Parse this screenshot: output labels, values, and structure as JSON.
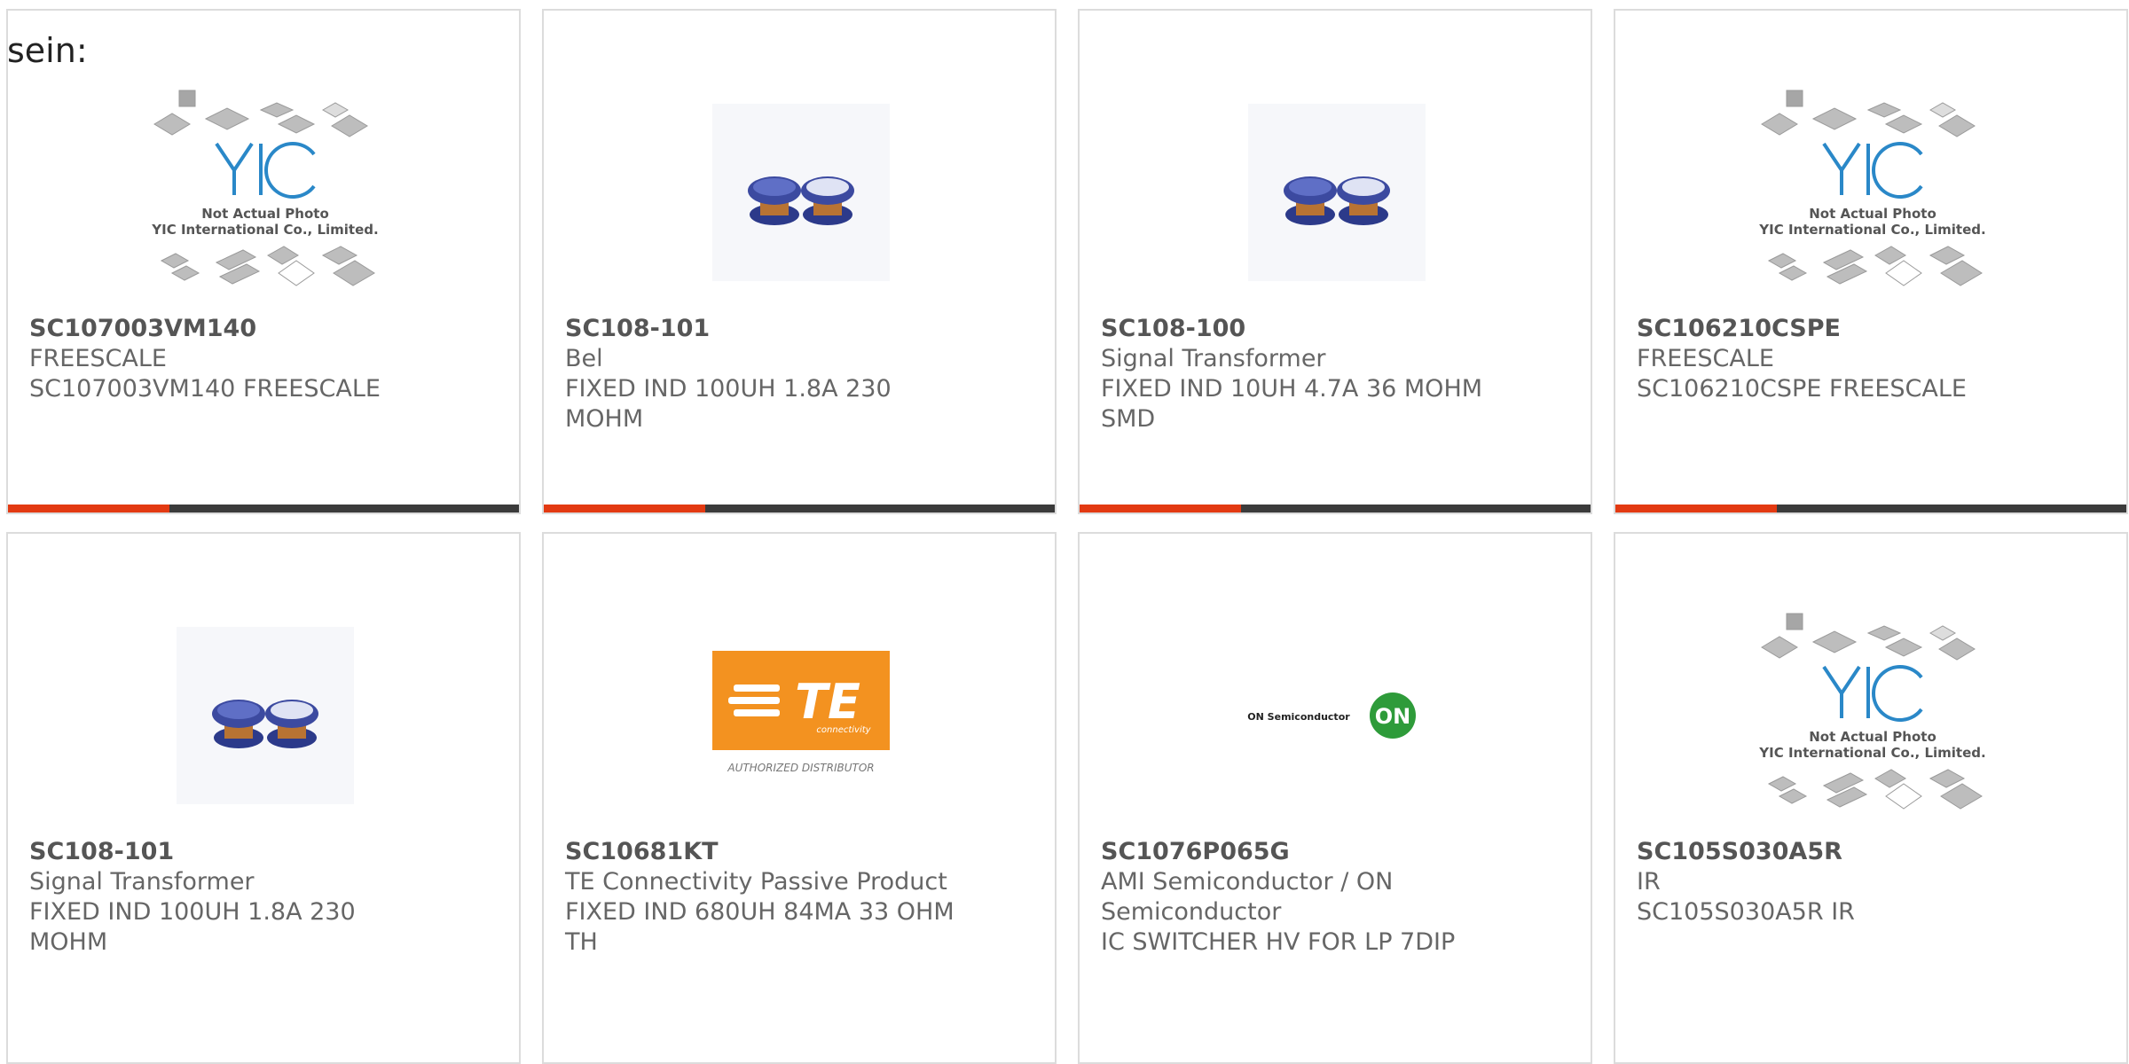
{
  "header": {
    "text": "sein:"
  },
  "colors": {
    "accent": "#e33a12",
    "bar": "#3b3b3b",
    "te_orange": "#f39220",
    "on_green": "#2e9b3a"
  },
  "placeholder": {
    "line1": "Not Actual Photo",
    "line2": "YIC International Co., Limited.",
    "logo": "YIC"
  },
  "te_logo": {
    "brand": "TE",
    "sub": "connectivity",
    "caption": "AUTHORIZED DISTRIBUTOR"
  },
  "on_logo": {
    "name": "ON Semiconductor",
    "mark": "ON"
  },
  "products": [
    {
      "part_number": "SC107003VM140",
      "manufacturer": "FREESCALE",
      "description": "SC107003VM140 FREESCALE",
      "image": "yic-placeholder"
    },
    {
      "part_number": "SC108-101",
      "manufacturer": "Bel",
      "description": "FIXED IND 100UH 1.8A 230 MOHM",
      "image": "inductor-photo"
    },
    {
      "part_number": "SC108-100",
      "manufacturer": "Signal Transformer",
      "description": "FIXED IND 10UH 4.7A 36 MOHM SMD",
      "image": "inductor-photo"
    },
    {
      "part_number": "SC106210CSPE",
      "manufacturer": "FREESCALE",
      "description": "SC106210CSPE FREESCALE",
      "image": "yic-placeholder"
    },
    {
      "part_number": "SC108-101",
      "manufacturer": "Signal Transformer",
      "description": "FIXED IND 100UH 1.8A 230 MOHM",
      "image": "inductor-photo"
    },
    {
      "part_number": "SC10681KT",
      "manufacturer": "TE Connectivity Passive Product",
      "description": "FIXED IND 680UH 84MA 33 OHM TH",
      "image": "te-logo"
    },
    {
      "part_number": "SC1076P065G",
      "manufacturer": "AMI Semiconductor / ON Semiconductor",
      "description": "IC SWITCHER HV FOR LP 7DIP",
      "image": "on-semi-logo"
    },
    {
      "part_number": "SC105S030A5R",
      "manufacturer": "IR",
      "description": "SC105S030A5R IR",
      "image": "yic-placeholder"
    }
  ]
}
